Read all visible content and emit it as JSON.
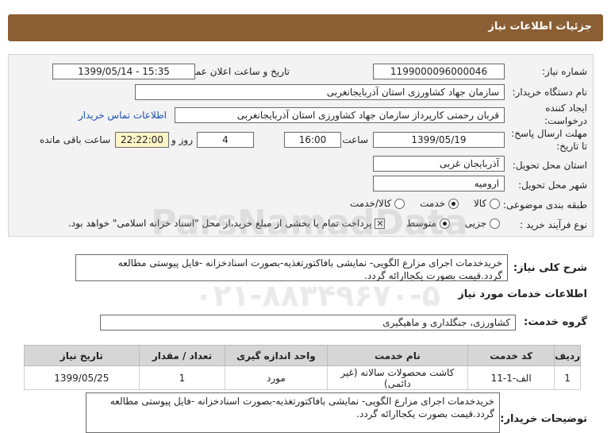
{
  "header": {
    "title": "جزئیات اطلاعات نیاز"
  },
  "fields": {
    "need_number_label": "شماره نیاز:",
    "need_number_value": "1199000096000046",
    "announce_label": "تاریخ و ساعت اعلان عمومی:",
    "announce_value": "1399/05/14 - 15:35",
    "buyer_org_label": "نام دستگاه خریدار:",
    "buyer_org_value": "سازمان جهاد کشاورزی استان آذربایجانغربی",
    "creator_label_1": "ایجاد کننده",
    "creator_label_2": "درخواست:",
    "creator_value": "قربان  رحمتی  کارپرداز سازمان جهاد کشاورزی استان آذربایجانغربی",
    "contact_link": "اطلاعات تماس خریدار",
    "deadline_label_1": "مهلت ارسال پاسخ:",
    "deadline_label_2": "تا تاریخ:",
    "deadline_date": "1399/05/19",
    "time_label": "ساعت",
    "deadline_time": "16:00",
    "days_value": "4",
    "days_label": "روز و",
    "remaining_time": "22:22:00",
    "remaining_label": "ساعت باقی مانده",
    "province_label": "استان محل تحویل:",
    "province_value": "آذربایجان غربی",
    "city_label": "شهر محل تحویل:",
    "city_value": "ارومیه",
    "category_label": "طبقه بندی موضوعی:",
    "category_options": [
      "کالا",
      "خدمت",
      "کالا/خدمت"
    ],
    "category_selected": "خدمت",
    "process_label": "نوع فرآیند خرید :",
    "process_options": [
      "جزیی",
      "متوسط"
    ],
    "process_selected": "متوسط",
    "payment_note": "پرداخت تمام یا بخشی از مبلغ خرید،از محل \"اسناد خزانه اسلامی\" خواهد بود."
  },
  "summary": {
    "label": "شرح کلی نیاز:",
    "text": "خریدخدمات اجرای مزارع الگویی- نمایشی بافاکتورتغذیه-بصورت اسنادخزانه -فایل پیوستی مطالعه گردد.قیمت بصورت یکجاارائه گردد."
  },
  "services_section": {
    "title": "اطلاعات خدمات مورد نیاز"
  },
  "service_group": {
    "label": "گروه خدمت:",
    "value": "کشاورزی، جنگلداری و ماهیگیری"
  },
  "table": {
    "headers": [
      "ردیف",
      "کد خدمت",
      "نام خدمت",
      "واحد اندازه گیری",
      "تعداد / مقدار",
      "تاریخ نیاز"
    ],
    "rows": [
      [
        "1",
        "الف-1-11",
        "کاشت محصولات سالانه (غیر دائمی)",
        "مورد",
        "1",
        "1399/05/25"
      ]
    ]
  },
  "buyer_notes": {
    "label": "توضیحات خریدار:",
    "text": "خریدخدمات اجرای مزارع الگویی- نمایشی بافاکتورتغذیه-بصورت اسنادخزانه -فایل پیوستی مطالعه گردد.قیمت بصورت یکجاارائه گردد."
  },
  "watermark": {
    "line1": "ParsNamadData",
    "line2": "۰۲۱-۸۸۳۴۹۶۷۰-۵"
  }
}
